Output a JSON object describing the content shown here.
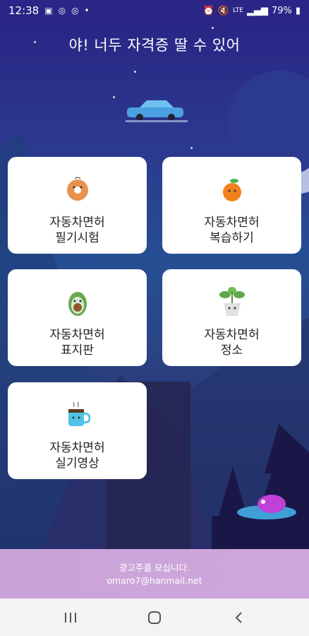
{
  "status_bar": {
    "time": "12:38",
    "battery": "79%",
    "network": "LTE"
  },
  "title": "야! 너두 자격증 딸 수 있어",
  "menu": [
    {
      "line1": "자동차면허",
      "line2": "필기시험",
      "icon": "donut-icon"
    },
    {
      "line1": "자동차면허",
      "line2": "복습하기",
      "icon": "orange-icon"
    },
    {
      "line1": "자동차면허",
      "line2": "표지판",
      "icon": "avocado-icon"
    },
    {
      "line1": "자동차면허",
      "line2": "정소",
      "icon": "plant-icon"
    },
    {
      "line1": "자동차면허",
      "line2": "실기영상",
      "icon": "mug-icon"
    }
  ],
  "ad": {
    "line1": "광고주를 모십니다.",
    "line2": "omaro7@hanmail.net"
  },
  "colors": {
    "sky_top": "#2a2686",
    "sky_mid": "#264f94",
    "ad_bar": "#c9a4d8",
    "card": "#ffffff"
  }
}
